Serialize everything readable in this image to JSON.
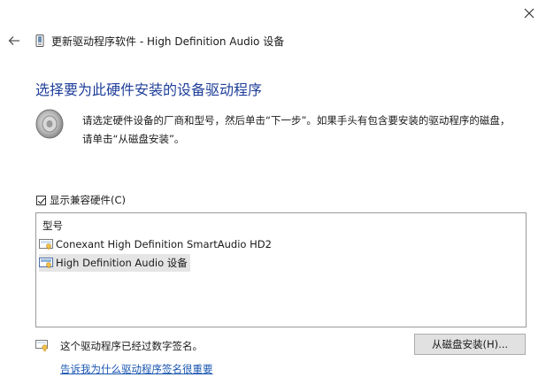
{
  "titlebar": {
    "title": "更新驱动程序软件 - High Definition Audio 设备",
    "back_icon": "back-arrow-icon",
    "close_icon": "close-icon"
  },
  "main": {
    "heading": "选择要为此硬件安装的设备驱动程序",
    "instruction_line1": "请选定硬件设备的厂商和型号，然后单击“下一步”。如果手头有包含要安装的驱动程序的磁盘，",
    "instruction_line2": "请单击“从磁盘安装”。",
    "show_compatible": {
      "label": "显示兼容硬件(C)",
      "checked": true
    },
    "model_list": {
      "header": "型号",
      "items": [
        {
          "label": "Conexant High Definition SmartAudio HD2",
          "selected": false
        },
        {
          "label": "High Definition Audio 设备",
          "selected": true
        }
      ]
    },
    "signature_status": "这个驱动程序已经过数字签名。",
    "signature_link": "告诉我为什么驱动程序签名很重要",
    "install_from_disk": "从磁盘安装(H)..."
  },
  "colors": {
    "heading": "#1f3f9a",
    "link": "#1a56b0",
    "selected_row": "#e5e5e5",
    "button_bg": "#e1e1e1"
  }
}
